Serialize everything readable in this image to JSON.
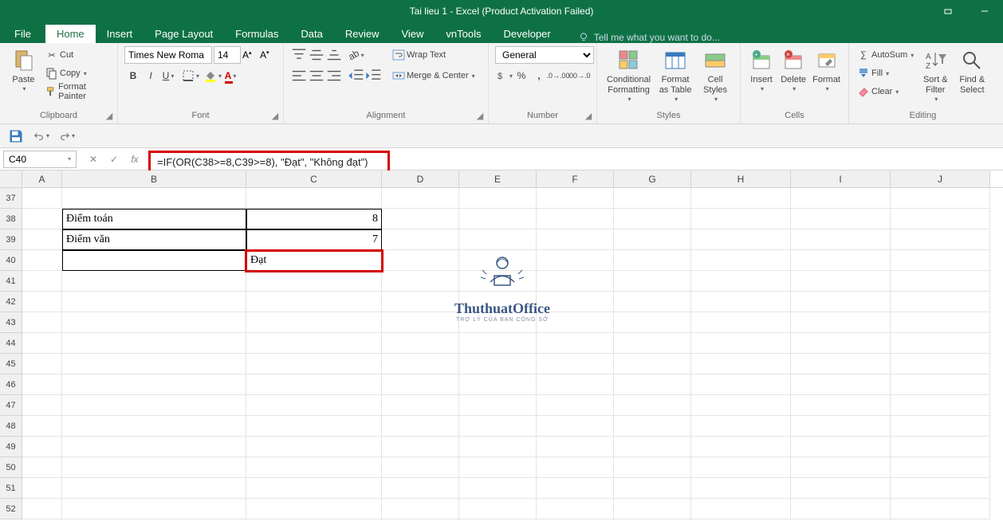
{
  "window": {
    "title": "Tai lieu 1 - Excel (Product Activation Failed)"
  },
  "tabs": {
    "file": "File",
    "home": "Home",
    "insert": "Insert",
    "pageLayout": "Page Layout",
    "formulas": "Formulas",
    "data": "Data",
    "review": "Review",
    "view": "View",
    "vntools": "vnTools",
    "developer": "Developer",
    "tellMe": "Tell me what you want to do..."
  },
  "ribbon": {
    "clipboard": {
      "label": "Clipboard",
      "paste": "Paste",
      "cut": "Cut",
      "copy": "Copy",
      "formatPainter": "Format Painter"
    },
    "font": {
      "label": "Font",
      "name": "Times New Roma",
      "size": "14"
    },
    "alignment": {
      "label": "Alignment",
      "wrap": "Wrap Text",
      "merge": "Merge & Center"
    },
    "number": {
      "label": "Number",
      "format": "General"
    },
    "styles": {
      "label": "Styles",
      "cond": "Conditional Formatting",
      "table": "Format as Table",
      "cell": "Cell Styles"
    },
    "cells": {
      "label": "Cells",
      "insert": "Insert",
      "delete": "Delete",
      "format": "Format"
    },
    "editing": {
      "label": "Editing",
      "autosum": "AutoSum",
      "fill": "Fill",
      "clear": "Clear",
      "sort": "Sort & Filter",
      "find": "Find & Select"
    }
  },
  "nameBox": "C40",
  "formula": "=IF(OR(C38>=8,C39>=8), \"Đạt\", \"Không đạt\")",
  "columns": [
    "A",
    "B",
    "C",
    "D",
    "E",
    "F",
    "G",
    "H",
    "I",
    "J"
  ],
  "rows": [
    37,
    38,
    39,
    40,
    41,
    42,
    43,
    44,
    45,
    46,
    47,
    48,
    49,
    50,
    51,
    52
  ],
  "cells": {
    "B38": "Điểm toán",
    "C38": "8",
    "B39": "Điểm văn",
    "C39": "7",
    "C40": "Đạt"
  },
  "watermark": {
    "title": "ThuthuatOffice",
    "sub": "TRỢ LÝ CỦA BẠN CÔNG SỞ"
  }
}
